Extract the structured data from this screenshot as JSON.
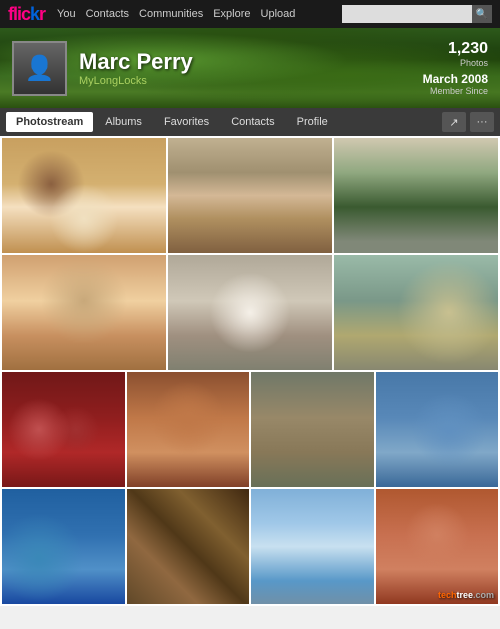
{
  "app": {
    "name": "flickr",
    "name_color1": "flick",
    "name_color2": "r"
  },
  "top_nav": {
    "links": [
      "You",
      "Contacts",
      "Communities",
      "Explore",
      "Upload"
    ],
    "search_placeholder": ""
  },
  "profile": {
    "name": "Marc Perry",
    "username": "MyLongLocks",
    "photos_count": "1,230",
    "photos_label": "Photos",
    "member_since": "March 2008",
    "member_label": "Member Since"
  },
  "sub_nav": {
    "tabs": [
      "Photostream",
      "Albums",
      "Favorites",
      "Contacts",
      "Profile"
    ],
    "active_tab": "Photostream"
  },
  "actions": {
    "share_icon": "↗",
    "more_icon": "···"
  },
  "watermark": {
    "prefix": "tech",
    "accent": "tree",
    "suffix": ".com"
  }
}
